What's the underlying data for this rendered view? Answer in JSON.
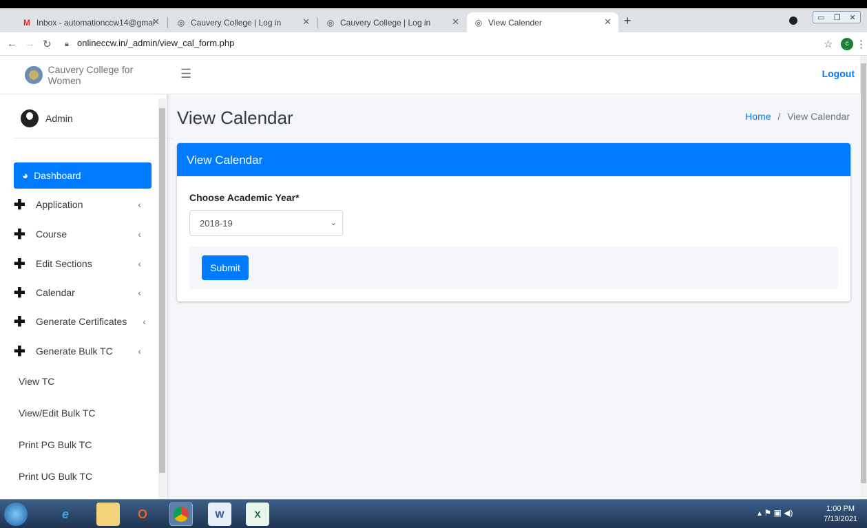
{
  "browser": {
    "tabs": [
      {
        "title": "Inbox - automationccw14@gmai",
        "icon": "gmail-icon"
      },
      {
        "title": "Cauvery College | Log in",
        "icon": "globe-icon"
      },
      {
        "title": "Cauvery College | Log in",
        "icon": "globe-icon"
      },
      {
        "title": "View Calender",
        "icon": "globe-icon"
      }
    ],
    "new_tab": "+",
    "url": "onlineccw.in/_admin/view_cal_form.php",
    "profile_initial": "c"
  },
  "sidebar": {
    "brand": "Cauvery College for Women",
    "user": "Admin",
    "items": [
      {
        "label": "Dashboard",
        "icon": "dashboard-icon",
        "active": true,
        "has_plus": false,
        "has_chevron": false
      },
      {
        "label": "Application",
        "has_plus": true,
        "has_chevron": true
      },
      {
        "label": "Course",
        "has_plus": true,
        "has_chevron": true
      },
      {
        "label": "Edit Sections",
        "has_plus": true,
        "has_chevron": true
      },
      {
        "label": "Calendar",
        "has_plus": true,
        "has_chevron": true
      },
      {
        "label": "Generate Certificates",
        "has_plus": true,
        "has_chevron": true
      },
      {
        "label": "Generate Bulk TC",
        "has_plus": true,
        "has_chevron": true
      },
      {
        "label": "View TC",
        "has_plus": false,
        "has_chevron": false
      },
      {
        "label": "View/Edit Bulk TC",
        "has_plus": false,
        "has_chevron": false
      },
      {
        "label": "Print PG Bulk TC",
        "has_plus": false,
        "has_chevron": false
      },
      {
        "label": "Print UG Bulk TC",
        "has_plus": false,
        "has_chevron": false
      }
    ]
  },
  "topnav": {
    "logout": "Logout"
  },
  "main": {
    "title": "View Calendar",
    "breadcrumb": {
      "home": "Home",
      "separator": "/",
      "current": "View Calendar"
    },
    "card": {
      "header": "View Calendar",
      "label": "Choose Academic Year*",
      "select_value": "2018-19",
      "submit": "Submit"
    }
  },
  "taskbar": {
    "time": "1:00 PM",
    "date": "7/13/2021"
  },
  "colors": {
    "accent": "#007bff",
    "page_bg": "#f4f6f9"
  }
}
